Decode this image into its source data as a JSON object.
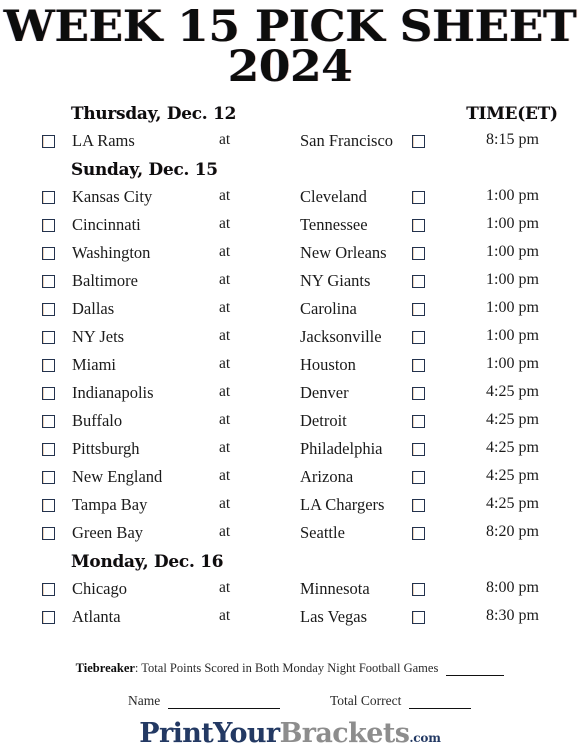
{
  "title": {
    "line1": "WEEK 15 PICK SHEET",
    "line2": "2024"
  },
  "columns": {
    "time_header": "TIME(ET)",
    "at_label": "at"
  },
  "sections": [
    {
      "day": "Thursday, Dec. 12",
      "games": [
        {
          "away": "LA Rams",
          "home": "San Francisco",
          "time": "8:15 pm"
        }
      ]
    },
    {
      "day": "Sunday, Dec. 15",
      "games": [
        {
          "away": "Kansas City",
          "home": "Cleveland",
          "time": "1:00 pm"
        },
        {
          "away": "Cincinnati",
          "home": "Tennessee",
          "time": "1:00 pm"
        },
        {
          "away": "Washington",
          "home": "New Orleans",
          "time": "1:00 pm"
        },
        {
          "away": "Baltimore",
          "home": "NY Giants",
          "time": "1:00 pm"
        },
        {
          "away": "Dallas",
          "home": "Carolina",
          "time": "1:00 pm"
        },
        {
          "away": "NY Jets",
          "home": "Jacksonville",
          "time": "1:00 pm"
        },
        {
          "away": "Miami",
          "home": "Houston",
          "time": "1:00 pm"
        },
        {
          "away": "Indianapolis",
          "home": "Denver",
          "time": "4:25 pm"
        },
        {
          "away": "Buffalo",
          "home": "Detroit",
          "time": "4:25 pm"
        },
        {
          "away": "Pittsburgh",
          "home": "Philadelphia",
          "time": "4:25 pm"
        },
        {
          "away": "New England",
          "home": "Arizona",
          "time": "4:25 pm"
        },
        {
          "away": "Tampa Bay",
          "home": "LA Chargers",
          "time": "4:25 pm"
        },
        {
          "away": "Green Bay",
          "home": "Seattle",
          "time": "8:20 pm"
        }
      ]
    },
    {
      "day": "Monday, Dec. 16",
      "games": [
        {
          "away": "Chicago",
          "home": "Minnesota",
          "time": "8:00 pm"
        },
        {
          "away": "Atlanta",
          "home": "Las Vegas",
          "time": "8:30 pm"
        }
      ]
    }
  ],
  "footer": {
    "tiebreaker_label": "Tiebreaker",
    "tiebreaker_text": ": Total Points Scored in Both Monday Night Football Games",
    "name_label": "Name",
    "total_correct_label": "Total Correct"
  },
  "logo": {
    "part1": "PrintYour",
    "part2": "Brackets",
    "part3": ".com",
    "color_navy": "#233963",
    "color_gray": "#8d8d8d"
  }
}
